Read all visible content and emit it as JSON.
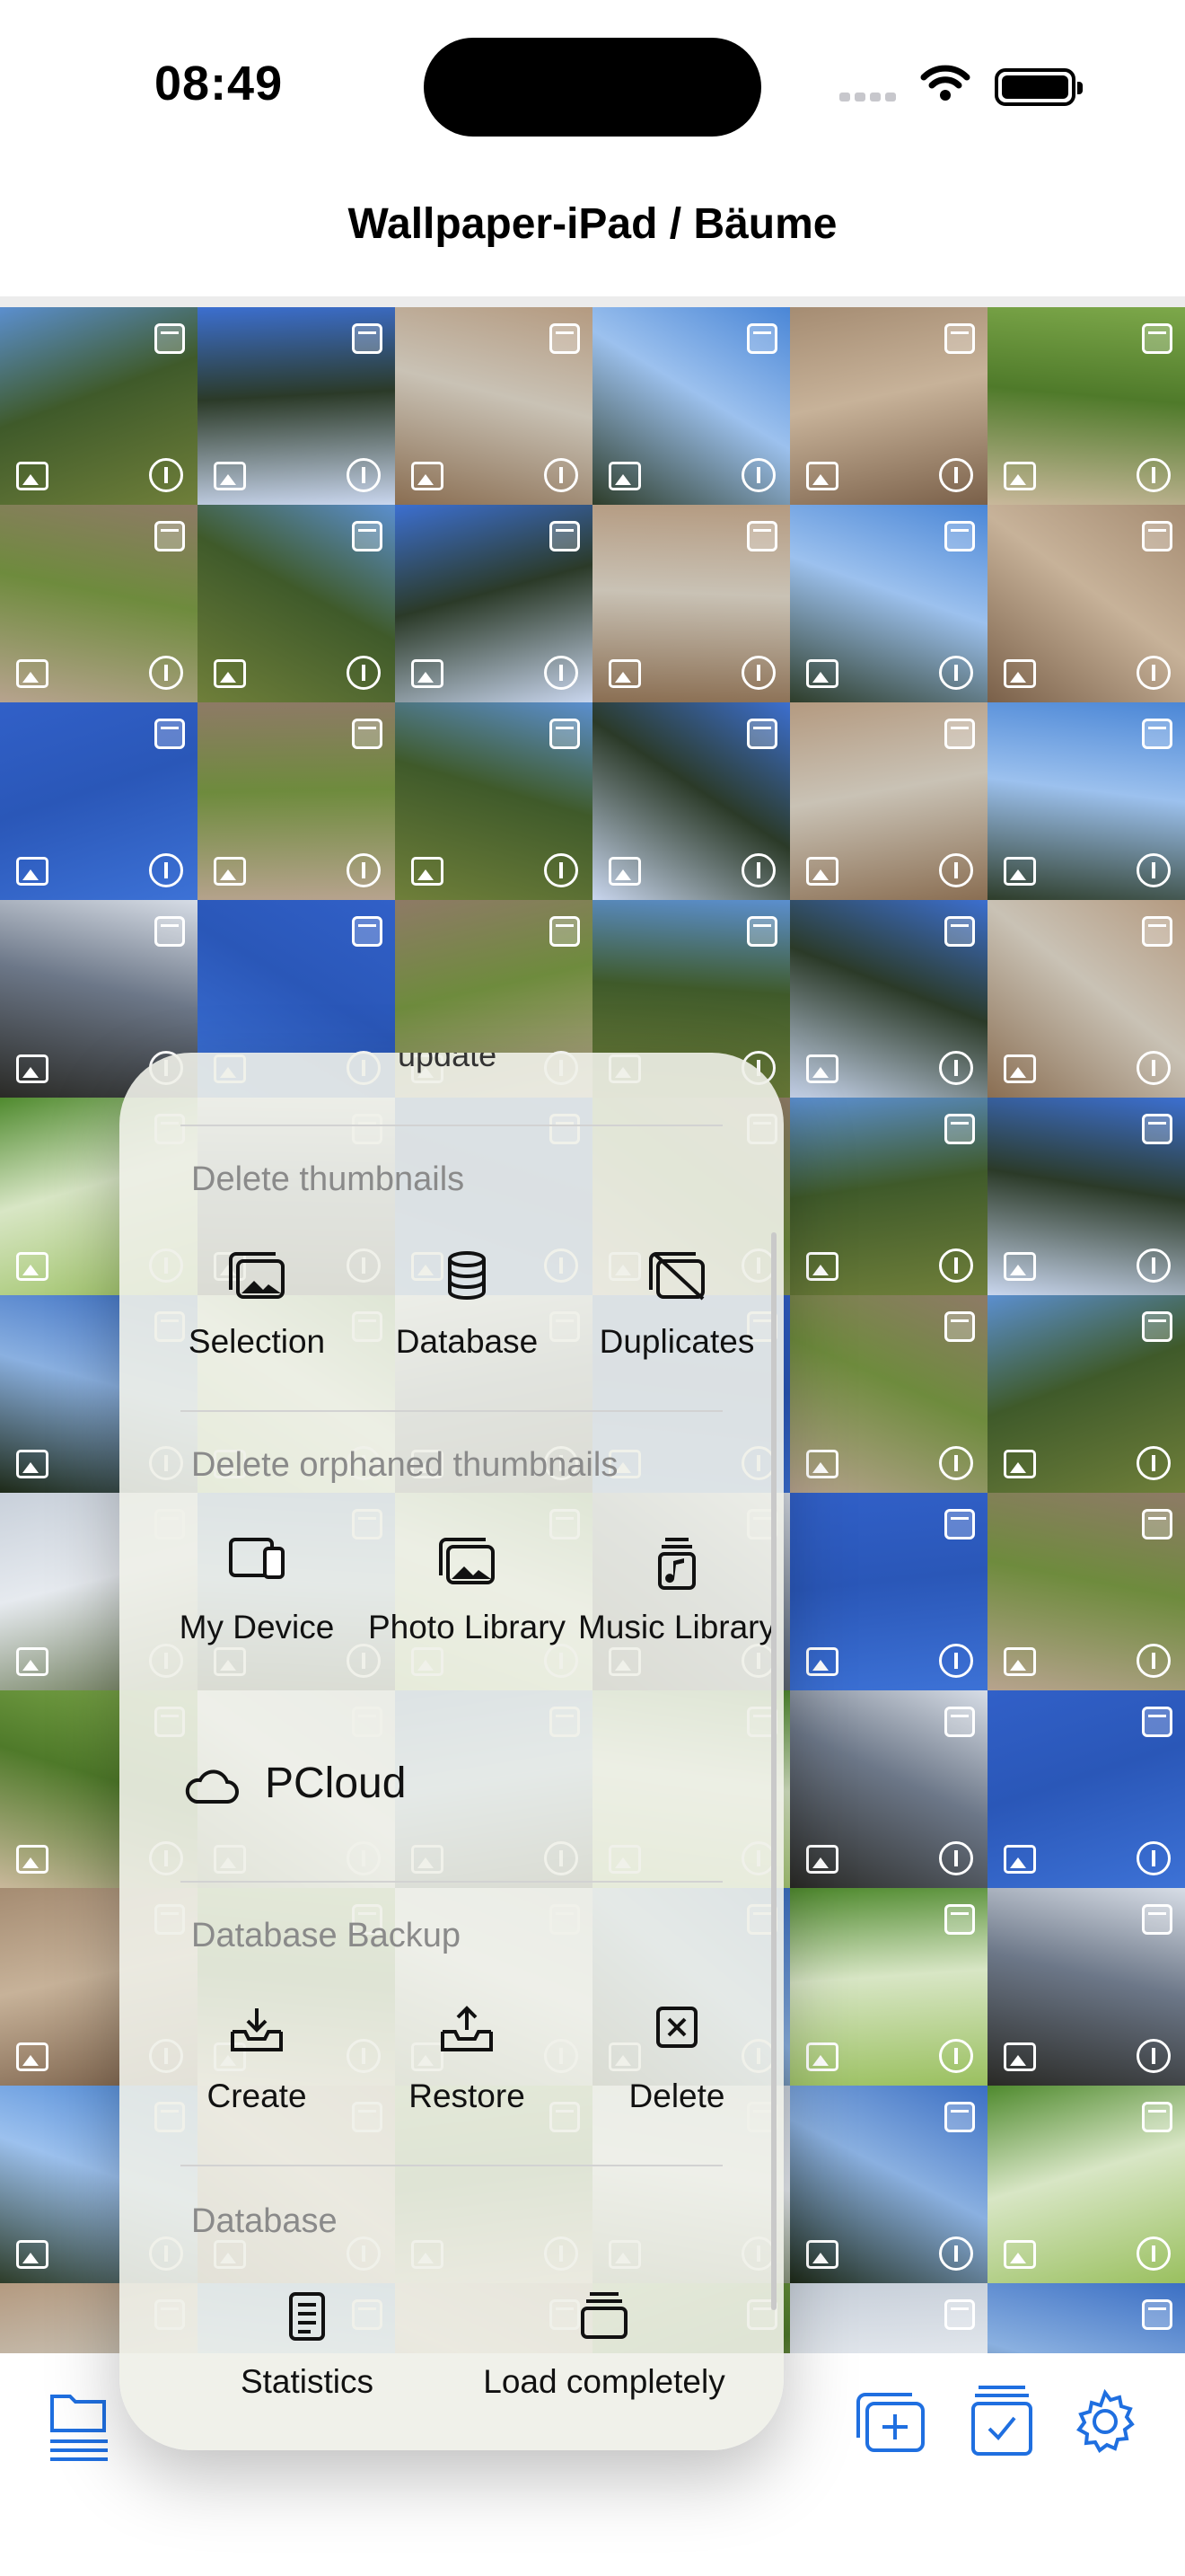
{
  "status_bar": {
    "time": "08:49"
  },
  "nav": {
    "title": "Wallpaper-iPad / Bäume"
  },
  "grid": {
    "palettes": [
      [
        "#5b8fcf",
        "#6f7f3a",
        "#3f5a2a"
      ],
      [
        "#3b6fc4",
        "#1e2a18",
        "#8ab0e0"
      ],
      [
        "#b49a80",
        "#8a6e52",
        "#c9c2b5"
      ],
      [
        "#d7dde6",
        "#2a2a26",
        "#6c7788"
      ],
      [
        "#a58c72",
        "#7a6049",
        "#c7b299"
      ],
      [
        "#8e7a66",
        "#b7a38e",
        "#6e8b3d"
      ],
      [
        "#c8d0da",
        "#6b7a56",
        "#e6eaef"
      ],
      [
        "#3c6fd0",
        "#c9d6ee",
        "#2b3a28"
      ],
      [
        "#4f8a2e",
        "#9ac05f",
        "#d8e6c5"
      ],
      [
        "#4a86d6",
        "#2e3d2a",
        "#9cc1ee"
      ],
      [
        "#3160c8",
        "#3d72d6",
        "#2a57b8"
      ],
      [
        "#7da84a",
        "#c9b89b",
        "#4f7a2a"
      ]
    ]
  },
  "menu": {
    "partial_top": "update",
    "delete_thumbnails": {
      "header": "Delete thumbnails",
      "items": [
        {
          "icon": "photo-stack-icon",
          "label": "Selection"
        },
        {
          "icon": "database-icon",
          "label": "Database"
        },
        {
          "icon": "photo-stack-slash-icon",
          "label": "Duplicates"
        }
      ]
    },
    "delete_orphaned": {
      "header": "Delete orphaned thumbnails",
      "items": [
        {
          "icon": "devices-icon",
          "label": "My Device"
        },
        {
          "icon": "photo-stack-icon",
          "label": "Photo Library"
        },
        {
          "icon": "music-stack-icon",
          "label": "Music Library"
        }
      ]
    },
    "pcloud": {
      "icon": "cloud-icon",
      "label": "PCloud"
    },
    "backup": {
      "header": "Database Backup",
      "items": [
        {
          "icon": "tray-download-icon",
          "label": "Create"
        },
        {
          "icon": "tray-upload-icon",
          "label": "Restore"
        },
        {
          "icon": "xmark-square-icon",
          "label": "Delete"
        }
      ]
    },
    "database": {
      "header": "Database",
      "items": [
        {
          "icon": "document-icon",
          "label": "Statistics"
        },
        {
          "icon": "stack-icon",
          "label": "Load completely"
        }
      ]
    }
  },
  "toolbar": {
    "left_icon": "folder-list-icon",
    "right_icons": [
      "add-stack-icon",
      "checklist-icon",
      "gear-icon"
    ],
    "accent": "#1f6fe0"
  }
}
